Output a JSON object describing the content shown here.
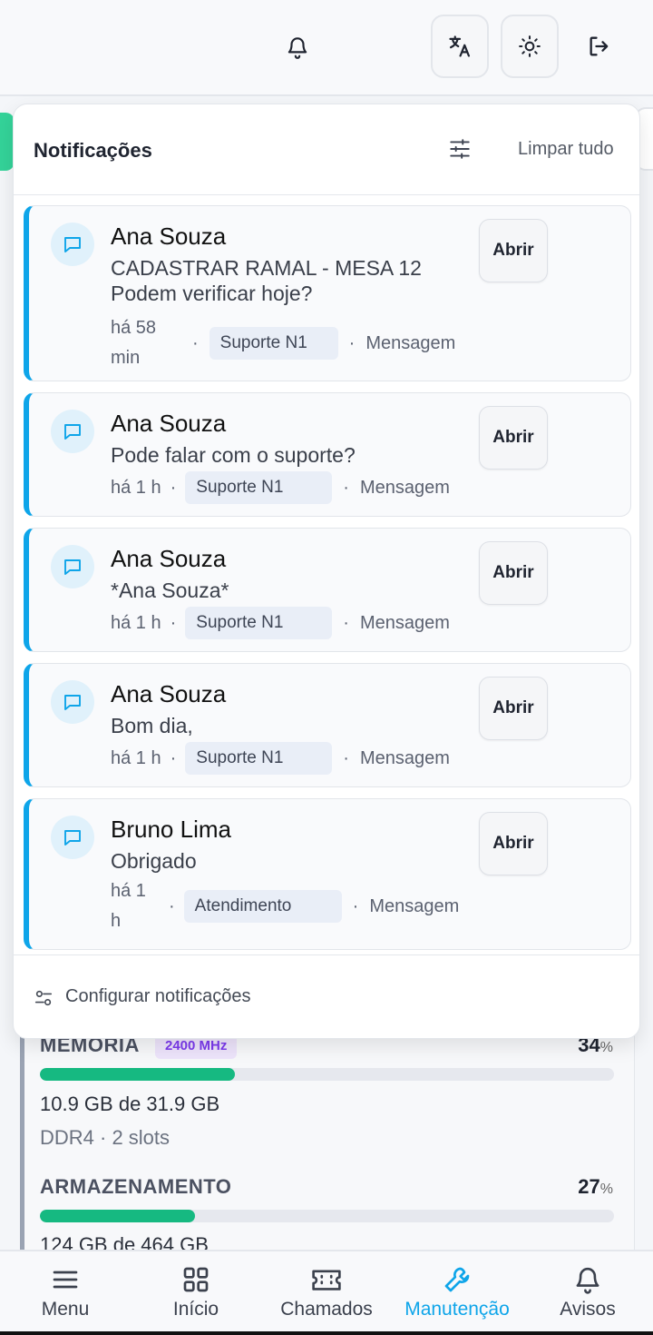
{
  "header": {
    "bell_icon": "bell-icon",
    "translate_icon": "translate-icon",
    "theme_icon": "sun-icon",
    "logout_icon": "logout-icon"
  },
  "background": {
    "memory": {
      "title": "MEMÓRIA",
      "speed": "2400 MHz",
      "percent_value": "34",
      "percent_sign": "%",
      "usage_fraction": 0.34,
      "used": "10.9 GB de 31.9 GB",
      "detail": "DDR4 · 2 slots"
    },
    "storage": {
      "title": "ARMAZENAMENTO",
      "percent_value": "27",
      "percent_sign": "%",
      "usage_fraction": 0.27,
      "used": "124 GB de 464 GB"
    }
  },
  "notifications": {
    "title": "Notificações",
    "clear_all": "Limpar tudo",
    "settings_label": "Configurar notificações",
    "accent_color": "#0ea5e9",
    "items": [
      {
        "name": "Ana Souza",
        "message_line1": "CADASTRAR RAMAL - MESA 12",
        "message_line2": "Podem verificar hoje?",
        "time_line1": "há 58",
        "time_line2": "min",
        "tag": "Suporte N1",
        "type": "Mensagem",
        "open_label": "Abrir"
      },
      {
        "name": "Ana Souza",
        "message_line1": "Pode falar com o suporte?",
        "time_line1": "há 1 h",
        "tag": "Suporte N1",
        "type": "Mensagem",
        "open_label": "Abrir"
      },
      {
        "name": "Ana Souza",
        "message_line1": "*Ana Souza*",
        "time_line1": "há 1 h",
        "tag": "Suporte N1",
        "type": "Mensagem",
        "open_label": "Abrir"
      },
      {
        "name": "Ana Souza",
        "message_line1": "Bom dia,",
        "time_line1": "há 1 h",
        "tag": "Suporte N1",
        "type": "Mensagem",
        "open_label": "Abrir"
      },
      {
        "name": "Bruno Lima",
        "message_line1": "Obrigado",
        "time_line1": "há 1",
        "time_line2": "h",
        "tag": "Atendimento",
        "type": "Mensagem",
        "open_label": "Abrir"
      }
    ]
  },
  "bottom_nav": {
    "active_color": "#0ea5e9",
    "items": [
      {
        "label": "Menu",
        "icon": "menu-icon"
      },
      {
        "label": "Início",
        "icon": "grid-icon"
      },
      {
        "label": "Chamados",
        "icon": "ticket-icon"
      },
      {
        "label": "Manutenção",
        "icon": "wrench-icon",
        "active": true
      },
      {
        "label": "Avisos",
        "icon": "bell-icon"
      }
    ]
  }
}
